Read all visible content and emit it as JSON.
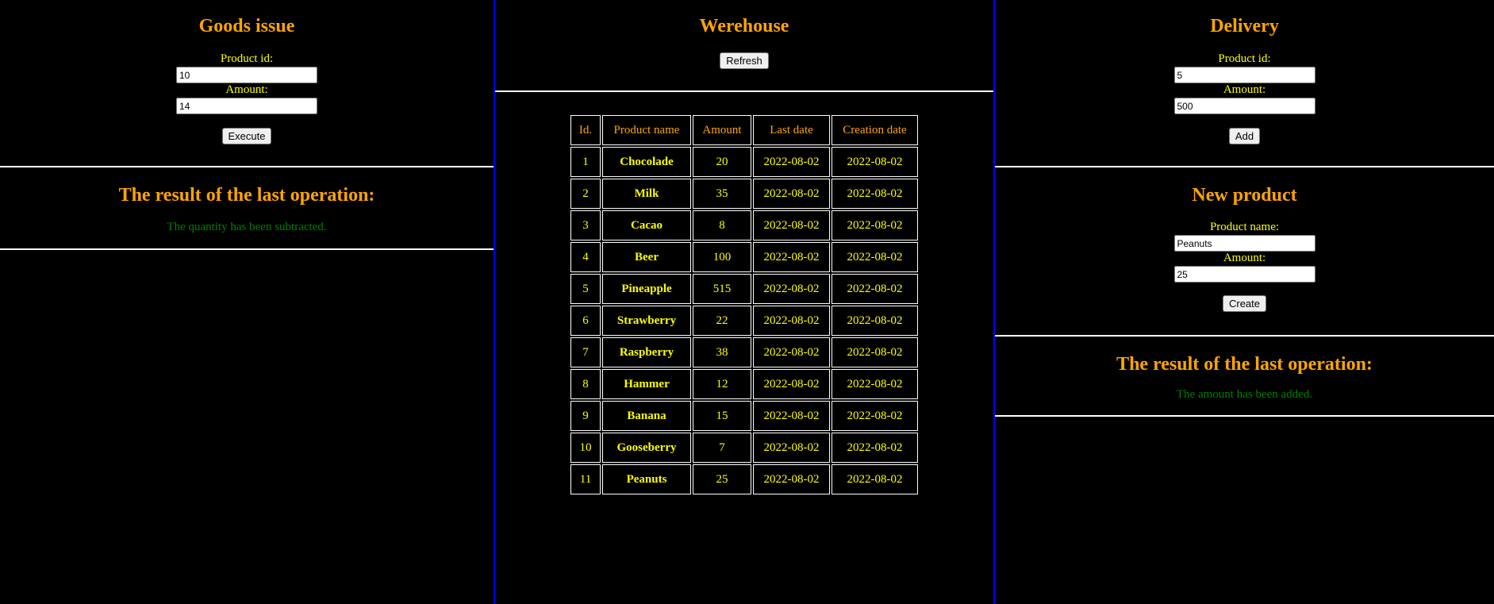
{
  "goods_issue": {
    "title": "Goods issue",
    "product_id_label": "Product id:",
    "product_id_value": "10",
    "amount_label": "Amount:",
    "amount_value": "14",
    "execute_label": "Execute"
  },
  "left_result": {
    "title": "The result of the last operation:",
    "message": "The quantity has been subtracted."
  },
  "warehouse": {
    "title": "Werehouse",
    "refresh_label": "Refresh",
    "columns": [
      "Id.",
      "Product name",
      "Amount",
      "Last date",
      "Creation date"
    ],
    "rows": [
      {
        "id": "1",
        "name": "Chocolade",
        "amount": "20",
        "last_date": "2022-08-02",
        "creation_date": "2022-08-02"
      },
      {
        "id": "2",
        "name": "Milk",
        "amount": "35",
        "last_date": "2022-08-02",
        "creation_date": "2022-08-02"
      },
      {
        "id": "3",
        "name": "Cacao",
        "amount": "8",
        "last_date": "2022-08-02",
        "creation_date": "2022-08-02"
      },
      {
        "id": "4",
        "name": "Beer",
        "amount": "100",
        "last_date": "2022-08-02",
        "creation_date": "2022-08-02"
      },
      {
        "id": "5",
        "name": "Pineapple",
        "amount": "515",
        "last_date": "2022-08-02",
        "creation_date": "2022-08-02"
      },
      {
        "id": "6",
        "name": "Strawberry",
        "amount": "22",
        "last_date": "2022-08-02",
        "creation_date": "2022-08-02"
      },
      {
        "id": "7",
        "name": "Raspberry",
        "amount": "38",
        "last_date": "2022-08-02",
        "creation_date": "2022-08-02"
      },
      {
        "id": "8",
        "name": "Hammer",
        "amount": "12",
        "last_date": "2022-08-02",
        "creation_date": "2022-08-02"
      },
      {
        "id": "9",
        "name": "Banana",
        "amount": "15",
        "last_date": "2022-08-02",
        "creation_date": "2022-08-02"
      },
      {
        "id": "10",
        "name": "Gooseberry",
        "amount": "7",
        "last_date": "2022-08-02",
        "creation_date": "2022-08-02"
      },
      {
        "id": "11",
        "name": "Peanuts",
        "amount": "25",
        "last_date": "2022-08-02",
        "creation_date": "2022-08-02"
      }
    ]
  },
  "delivery": {
    "title": "Delivery",
    "product_id_label": "Product id:",
    "product_id_value": "5",
    "amount_label": "Amount:",
    "amount_value": "500",
    "add_label": "Add"
  },
  "new_product": {
    "title": "New product",
    "product_name_label": "Product name:",
    "product_name_value": "Peanuts",
    "amount_label": "Amount:",
    "amount_value": "25",
    "create_label": "Create"
  },
  "right_result": {
    "title": "The result of the last operation:",
    "message": "The amount has been added."
  },
  "colors": {
    "background": "#000000",
    "heading": "#ffa500",
    "label": "#ffff00",
    "success": "#008000",
    "column_divider": "#0000ff",
    "section_divider": "#ffffff"
  }
}
